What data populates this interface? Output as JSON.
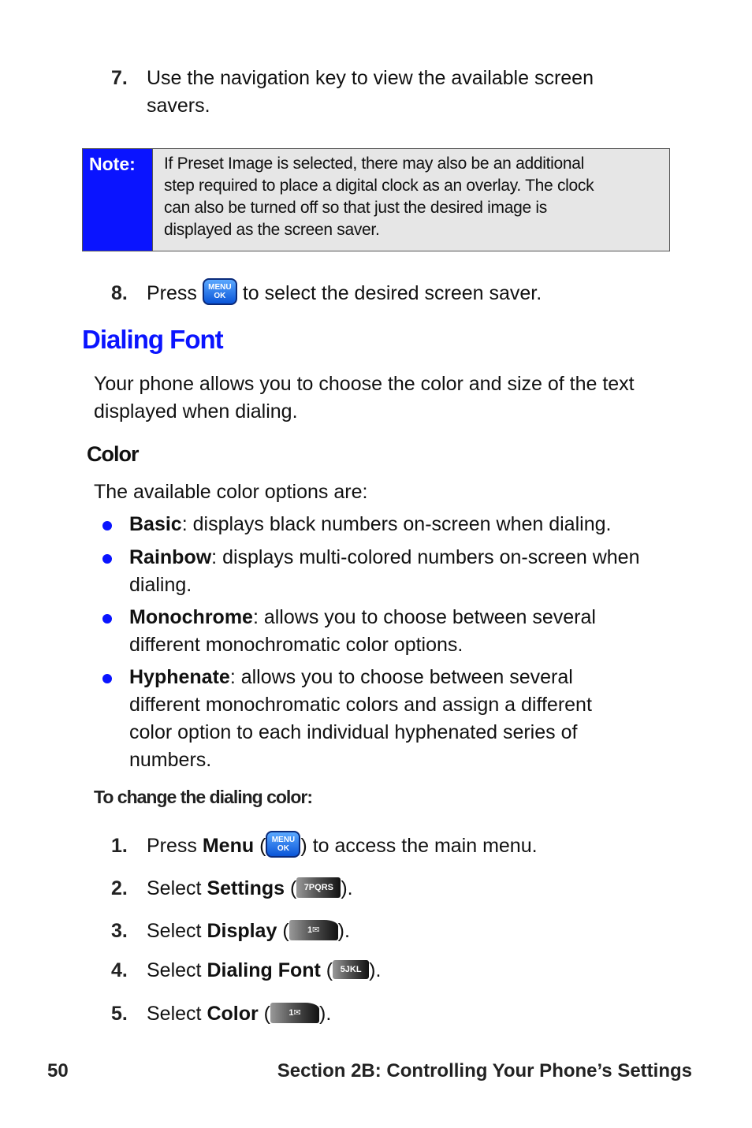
{
  "steps_top": [
    {
      "num": "7.",
      "lines": [
        "Use the navigation key to view the available screen",
        "savers."
      ]
    }
  ],
  "note": {
    "label": "Note:",
    "lines": [
      "If Preset Image is selected, there may also be an additional",
      "step required to place a digital clock as an overlay. The clock",
      "can also be turned off so that just the desired image is",
      "displayed as the screen saver."
    ]
  },
  "step8": {
    "num": "8.",
    "before": "Press",
    "key": {
      "name": "menu-ok-key-icon",
      "top": "MENU",
      "bottom": "OK"
    },
    "after": "to select the desired screen saver."
  },
  "heading": "Dialing Font",
  "intro": [
    "Your phone allows you to choose the color and size of the text",
    "displayed when dialing."
  ],
  "subheading": "Color",
  "options_intro": "The available color options are:",
  "bullet_color": "#0a14ff",
  "bullets": [
    {
      "term": "Basic",
      "lines": [
        ": displays black numbers on-screen when dialing."
      ]
    },
    {
      "term": "Rainbow",
      "lines": [
        ": displays multi-colored numbers on-screen when",
        "dialing."
      ]
    },
    {
      "term": "Monochrome",
      "lines": [
        ": allows you to choose between several",
        "different monochromatic color options."
      ]
    },
    {
      "term": "Hyphenate",
      "lines": [
        ": allows you to choose between several",
        "different monochromatic colors and assign a different",
        "color option to each individual hyphenated series of",
        "numbers."
      ]
    }
  ],
  "procedure_title": "To change the dialing color:",
  "procedure": [
    {
      "num": "1.",
      "pre": "Press ",
      "bold": "Menu",
      "post": ") to access the main menu.",
      "key": "MENU OK"
    },
    {
      "num": "2.",
      "pre": "Select ",
      "bold": "Settings",
      "post": ").",
      "key": "7PQRS"
    },
    {
      "num": "3.",
      "pre": "Select ",
      "bold": "Display",
      "post": ").",
      "key": "1✉"
    },
    {
      "num": "4.",
      "pre": "Select ",
      "bold": "Dialing Font",
      "post": ").",
      "key": "5JKL"
    },
    {
      "num": "5.",
      "pre": "Select ",
      "bold": "Color",
      "post": ").",
      "key": "1✉"
    }
  ],
  "footer": {
    "page": "50",
    "section": "Section 2B: Controlling Your Phone’s Settings"
  },
  "colors": {
    "accent_blue": "#0a14ff",
    "note_bg": "#e6e6e6"
  }
}
